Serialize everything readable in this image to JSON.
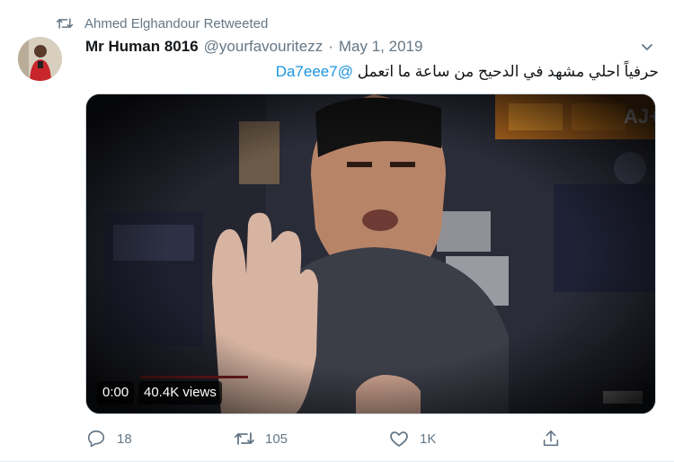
{
  "retweet_context": {
    "text": "Ahmed Elghandour Retweeted",
    "icon": "retweet-icon"
  },
  "author": {
    "display_name": "Mr Human 8016",
    "handle": "@yourfavouritezz",
    "separator": "·",
    "date": "May 1, 2019"
  },
  "tweet": {
    "text": "حرفياً احلي مشهد في الدحيح من ساعة ما اتعمل",
    "mention": "@Da7eee7"
  },
  "video": {
    "time": "0:00",
    "views": "40.4K views"
  },
  "actions": {
    "reply_count": "18",
    "retweet_count": "105",
    "like_count": "1K"
  },
  "colors": {
    "accent": "#1b95e0",
    "secondary_text": "#657786",
    "border": "#e6ecf0"
  }
}
